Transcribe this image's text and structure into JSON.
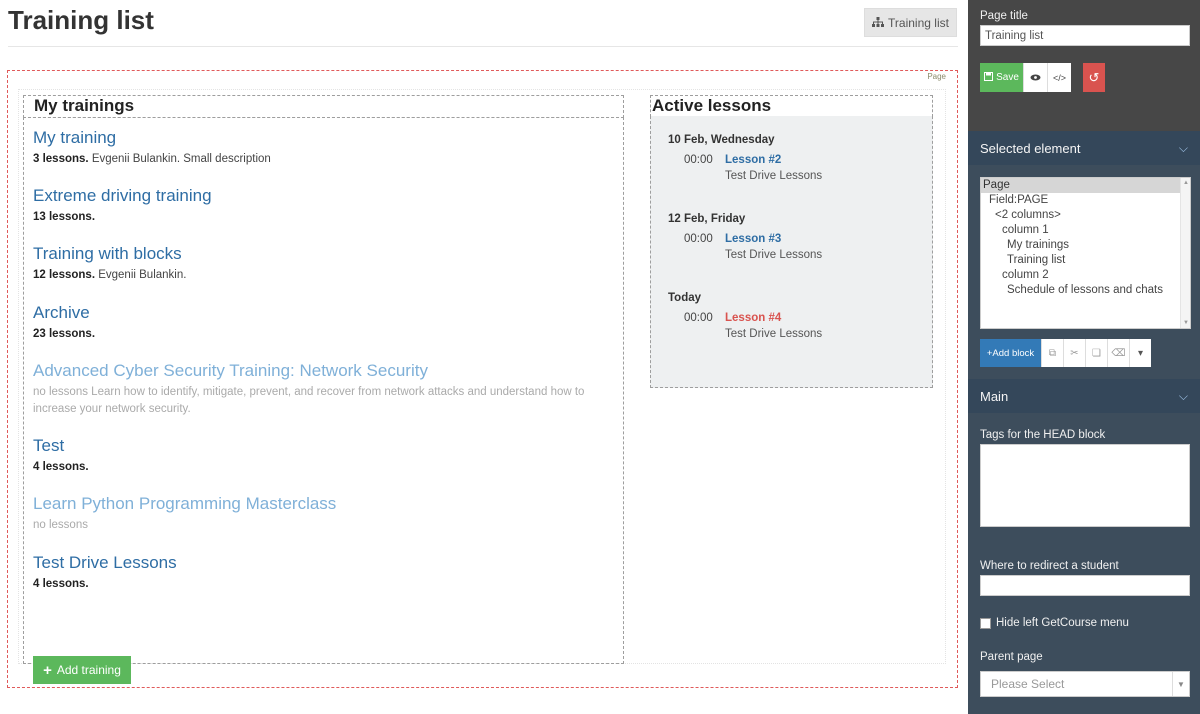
{
  "header": {
    "title": "Training list",
    "crumb_label": "Training list"
  },
  "page_tag": "Page",
  "my_trainings": {
    "title": "My trainings",
    "items": [
      {
        "name": "My training",
        "lessons": "3 lessons.",
        "extra": " Evgenii Bulankin. Small description"
      },
      {
        "name": "Extreme driving training",
        "lessons": "13 lessons.",
        "extra": ""
      },
      {
        "name": "Training with blocks",
        "lessons": "12 lessons.",
        "extra": " Evgenii Bulankin."
      },
      {
        "name": "Archive",
        "lessons": "23 lessons.",
        "extra": ""
      },
      {
        "name": "Advanced Cyber Security Training: Network Security",
        "lessons": "",
        "extra": "no lessons Learn how to identify, mitigate, prevent, and recover from network attacks and understand how to increase your network security."
      },
      {
        "name": "Test",
        "lessons": "4 lessons.",
        "extra": ""
      },
      {
        "name": "Learn Python Programming Masterclass",
        "lessons": "",
        "extra": "no lessons"
      },
      {
        "name": "Test Drive Lessons",
        "lessons": "4 lessons.",
        "extra": ""
      }
    ],
    "add_button": "Add training"
  },
  "active_lessons": {
    "title": "Active lessons",
    "days": [
      {
        "day": "10 Feb, Wednesday",
        "time": "00:00",
        "lesson": "Lesson #2",
        "course": "Test Drive Lessons"
      },
      {
        "day": "12 Feb, Friday",
        "time": "00:00",
        "lesson": "Lesson #3",
        "course": "Test Drive Lessons"
      },
      {
        "day": "Today",
        "time": "00:00",
        "lesson": "Lesson #4",
        "course": "Test Drive Lessons"
      }
    ]
  },
  "panel": {
    "page_title_label": "Page title",
    "page_title_value": "Training list",
    "save_label": "Save",
    "selected_element_label": "Selected element",
    "tree": [
      "Page",
      "Field:PAGE",
      "<2 columns>",
      "column 1",
      "My trainings",
      "Training list",
      "column 2",
      "Schedule of lessons and chats"
    ],
    "add_block_label": "+Add block",
    "main_label": "Main",
    "head_tags_label": "Tags for the HEAD block",
    "redirect_label": "Where to redirect a student",
    "hide_menu_label": "Hide left GetCourse menu",
    "parent_page_label": "Parent page",
    "parent_page_placeholder": "Please Select"
  },
  "colors": {
    "link": "#2e6da4",
    "muted_link": "#7fb0d8",
    "today_lesson": "#d9534f",
    "add_green": "#5cb85c",
    "panel_bg": "#3d4d5c"
  }
}
